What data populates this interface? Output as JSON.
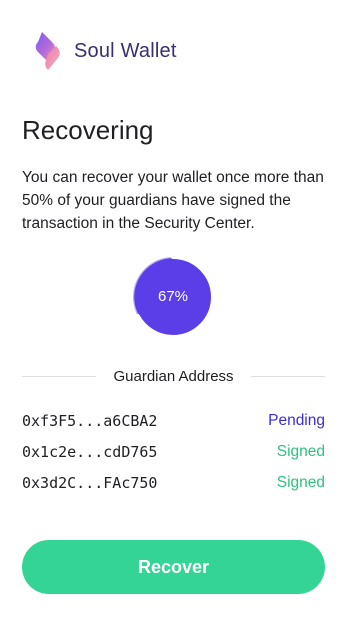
{
  "brand": {
    "name": "Soul Wallet",
    "logo_icon": "soul-wallet-logo-icon"
  },
  "page": {
    "title": "Recovering",
    "description": "You can recover your wallet once more than 50% of your guardians have signed the transaction in the Security Center."
  },
  "progress": {
    "label": "67%",
    "fraction": 0.67
  },
  "guardians": {
    "header": "Guardian Address",
    "items": [
      {
        "address": "0xf3F5...a6CBA2",
        "status": "Pending"
      },
      {
        "address": "0x1c2e...cdD765",
        "status": "Signed"
      },
      {
        "address": "0x3d2C...FAc750",
        "status": "Signed"
      }
    ]
  },
  "actions": {
    "recover_label": "Recover"
  },
  "colors": {
    "accent": "#5b3ee8",
    "progress_ring": "#5b3ee8",
    "pending": "#3b2fd1",
    "signed": "#2ec27e",
    "button": "#34d495",
    "brand_text": "#3a2f6e"
  }
}
